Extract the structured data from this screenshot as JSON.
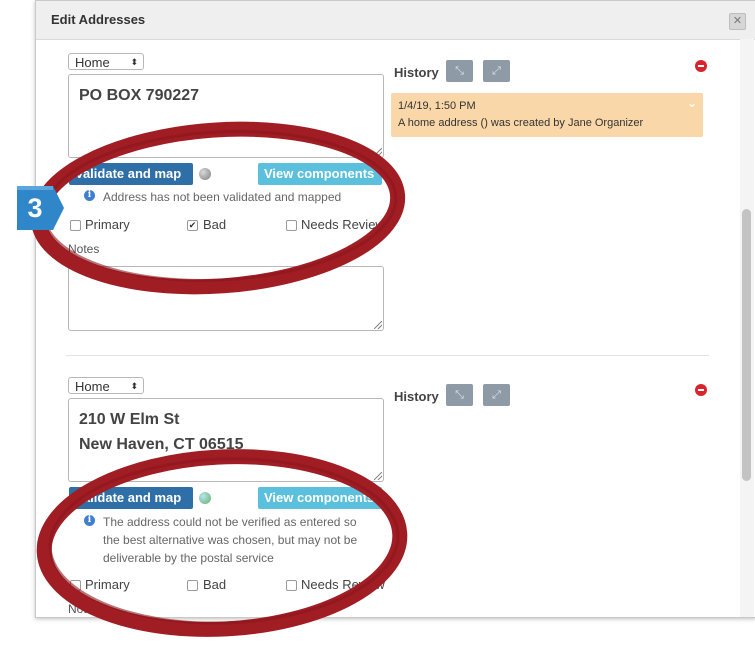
{
  "dialog": {
    "title": "Edit Addresses",
    "close_glyph": "✕"
  },
  "addresses": [
    {
      "type": "Home",
      "lines": [
        "PO BOX 790227"
      ],
      "validate_label": "Validate and map",
      "view_label": "View components",
      "status_dot_color": "#8a8a8a",
      "message_lines": [
        "Address has not been validated and mapped"
      ],
      "checkboxes": [
        {
          "label": "Primary",
          "checked": false,
          "glyph": ""
        },
        {
          "label": "Bad",
          "checked": true,
          "glyph": "✔"
        },
        {
          "label": "Needs Review",
          "checked": false,
          "glyph": ""
        }
      ],
      "notes_label": "Notes",
      "history_label": "History",
      "history_entries": [
        {
          "date": "1/4/19, 1:50 PM",
          "text": "A home address () was created by Jane Organizer"
        }
      ]
    },
    {
      "type": "Home",
      "lines": [
        "210 W Elm St",
        "New Haven, CT 06515"
      ],
      "validate_label": "Validate and map",
      "view_label": "View components",
      "status_dot_color": "#5fb35f",
      "message_lines": [
        "The address could not be verified as entered so",
        "the best alternative was chosen, but may not be",
        "deliverable by the postal service"
      ],
      "checkboxes": [
        {
          "label": "Primary",
          "checked": false,
          "glyph": ""
        },
        {
          "label": "Bad",
          "checked": false,
          "glyph": ""
        },
        {
          "label": "Needs Review",
          "checked": false,
          "glyph": ""
        }
      ],
      "notes_label": "Notes",
      "history_label": "History"
    }
  ],
  "annotation": {
    "step_number": "3",
    "badge_color": "#2f86c9",
    "circle_color": "#a11d24"
  },
  "icons": {
    "select_arrow": "⬍",
    "expand": "⤡",
    "collapse": "⤢",
    "info": "i",
    "chevron": "⌄"
  }
}
